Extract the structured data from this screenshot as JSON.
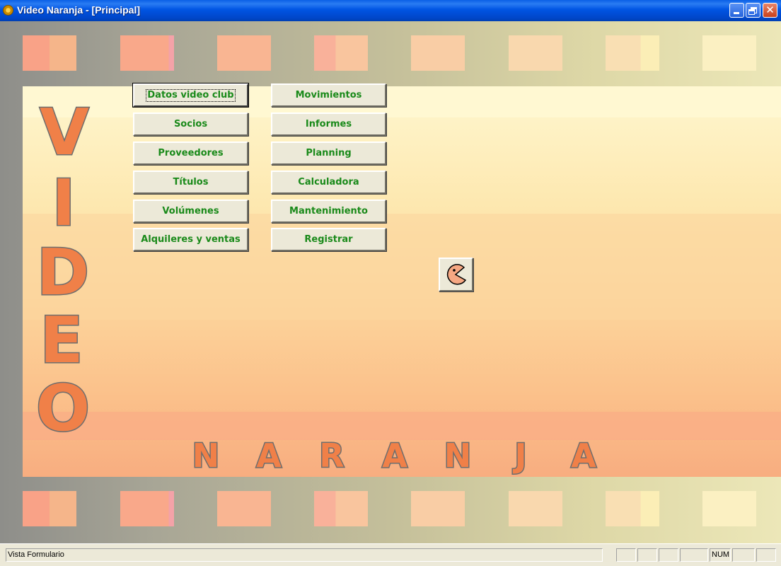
{
  "window": {
    "title": "Video Naranja - [Principal]",
    "icon": "app-logo-icon",
    "controls": [
      "minimize-icon",
      "restore-icon",
      "close-icon"
    ]
  },
  "menu": {
    "left": [
      "Datos video club",
      "Socios",
      "Proveedores",
      "Títulos",
      "Volúmenes",
      "Alquileres y ventas"
    ],
    "right": [
      "Movimientos",
      "Informes",
      "Planning",
      "Calculadora",
      "Mantenimiento",
      "Registrar"
    ],
    "focused": "Datos video club",
    "icon_button": "pacman-icon"
  },
  "logo": {
    "vertical": [
      "V",
      "I",
      "D",
      "E",
      "O"
    ],
    "horizontal": [
      "N",
      "A",
      "R",
      "A",
      "N",
      "J",
      "A"
    ]
  },
  "statusbar": {
    "text": "Vista Formulario",
    "num": "NUM"
  },
  "colors": {
    "button_text": "#1a8a1a",
    "logo_fill": "#f08048",
    "logo_outline": "#6e6e6e",
    "titlebar": "#0054e3"
  }
}
